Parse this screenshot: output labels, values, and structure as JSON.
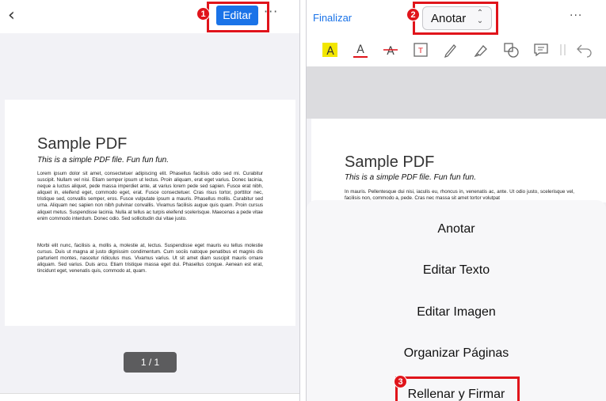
{
  "left": {
    "edit_button": "Editar",
    "page_indicator": "1 / 1",
    "badge_1": "1",
    "pdf": {
      "title": "Sample PDF",
      "subtitle": "This is a simple PDF file. Fun fun fun.",
      "paragraph_1": "Lorem ipsum dolor sit amet, consectetuer adipiscing elit. Phasellus facilisis odio sed mi. Curabitur suscipit. Nullam vel nisi. Etiam semper ipsum ut lectus. Proin aliquam, erat eget varius. Donec lacinia, neque a luctus aliquet, pede massa imperdiet ante, at varius lorem pede sed sapien. Fusce erat nibh, aliquet in, eleifend eget, commodo eget, erat. Fusce consectetuer. Cras risus tortor, porttitor nec, tristique sed, convallis semper, eros. Fusce vulputate ipsum a mauris. Phasellus mollis. Curabitur sed urna. Aliquam nec sapien non nibh pulvinar convallis. Vivamus facilisis augue quis quam. Proin cursus aliquet metus. Suspendisse lacinia. Nulla at tellus ac turpis eleifend scelerisque. Maecenas a pede vitae enim commodo interdum. Donec odio. Sed sollicitudin dui vitae justo.",
      "paragraph_2": "Morbi elit nunc, facilisis a, mollis a, molestie at, lectus. Suspendisse eget mauris eu tellus molestie cursus. Duis ut magna at justo dignissim condimentum. Cum sociis natoque penatibus et magnis dis parturient montes, nascetur ridiculus mus. Vivamus varius. Ut sit amet diam suscipit mauris ornare aliquam. Sed varius. Duis arcu. Etiam tristique massa eget dui. Phasellus congue. Aenean est erat, tincidunt eget, venenatis quis, commodo at, quam."
    }
  },
  "right": {
    "finish_link": "Finalizar",
    "mode_select": "Anotar",
    "badge_2": "2",
    "badge_3": "3",
    "pdf": {
      "title": "Sample PDF",
      "subtitle": "This is a simple PDF file. Fun fun fun.",
      "paragraph": "In mauris. Pellentesque dui nisi, iaculis eu, rhoncus in, venenatis ac, ante. Ut odio justo, scelerisque vel, facilisis non, commodo a, pede. Cras nec massa sit amet tortor volutpat"
    },
    "toolbar_icons": [
      "highlight-icon",
      "text-color-icon",
      "strikethrough-icon",
      "text-box-icon",
      "pencil-icon",
      "marker-icon",
      "shapes-icon",
      "comment-icon",
      "undo-icon"
    ],
    "menu": [
      "Anotar",
      "Editar Texto",
      "Editar Imagen",
      "Organizar Páginas",
      "Rellenar y Firmar"
    ]
  },
  "colors": {
    "accent": "#1a73e8",
    "highlight_red": "#e0141b",
    "highlight_yellow": "#f2e600"
  }
}
